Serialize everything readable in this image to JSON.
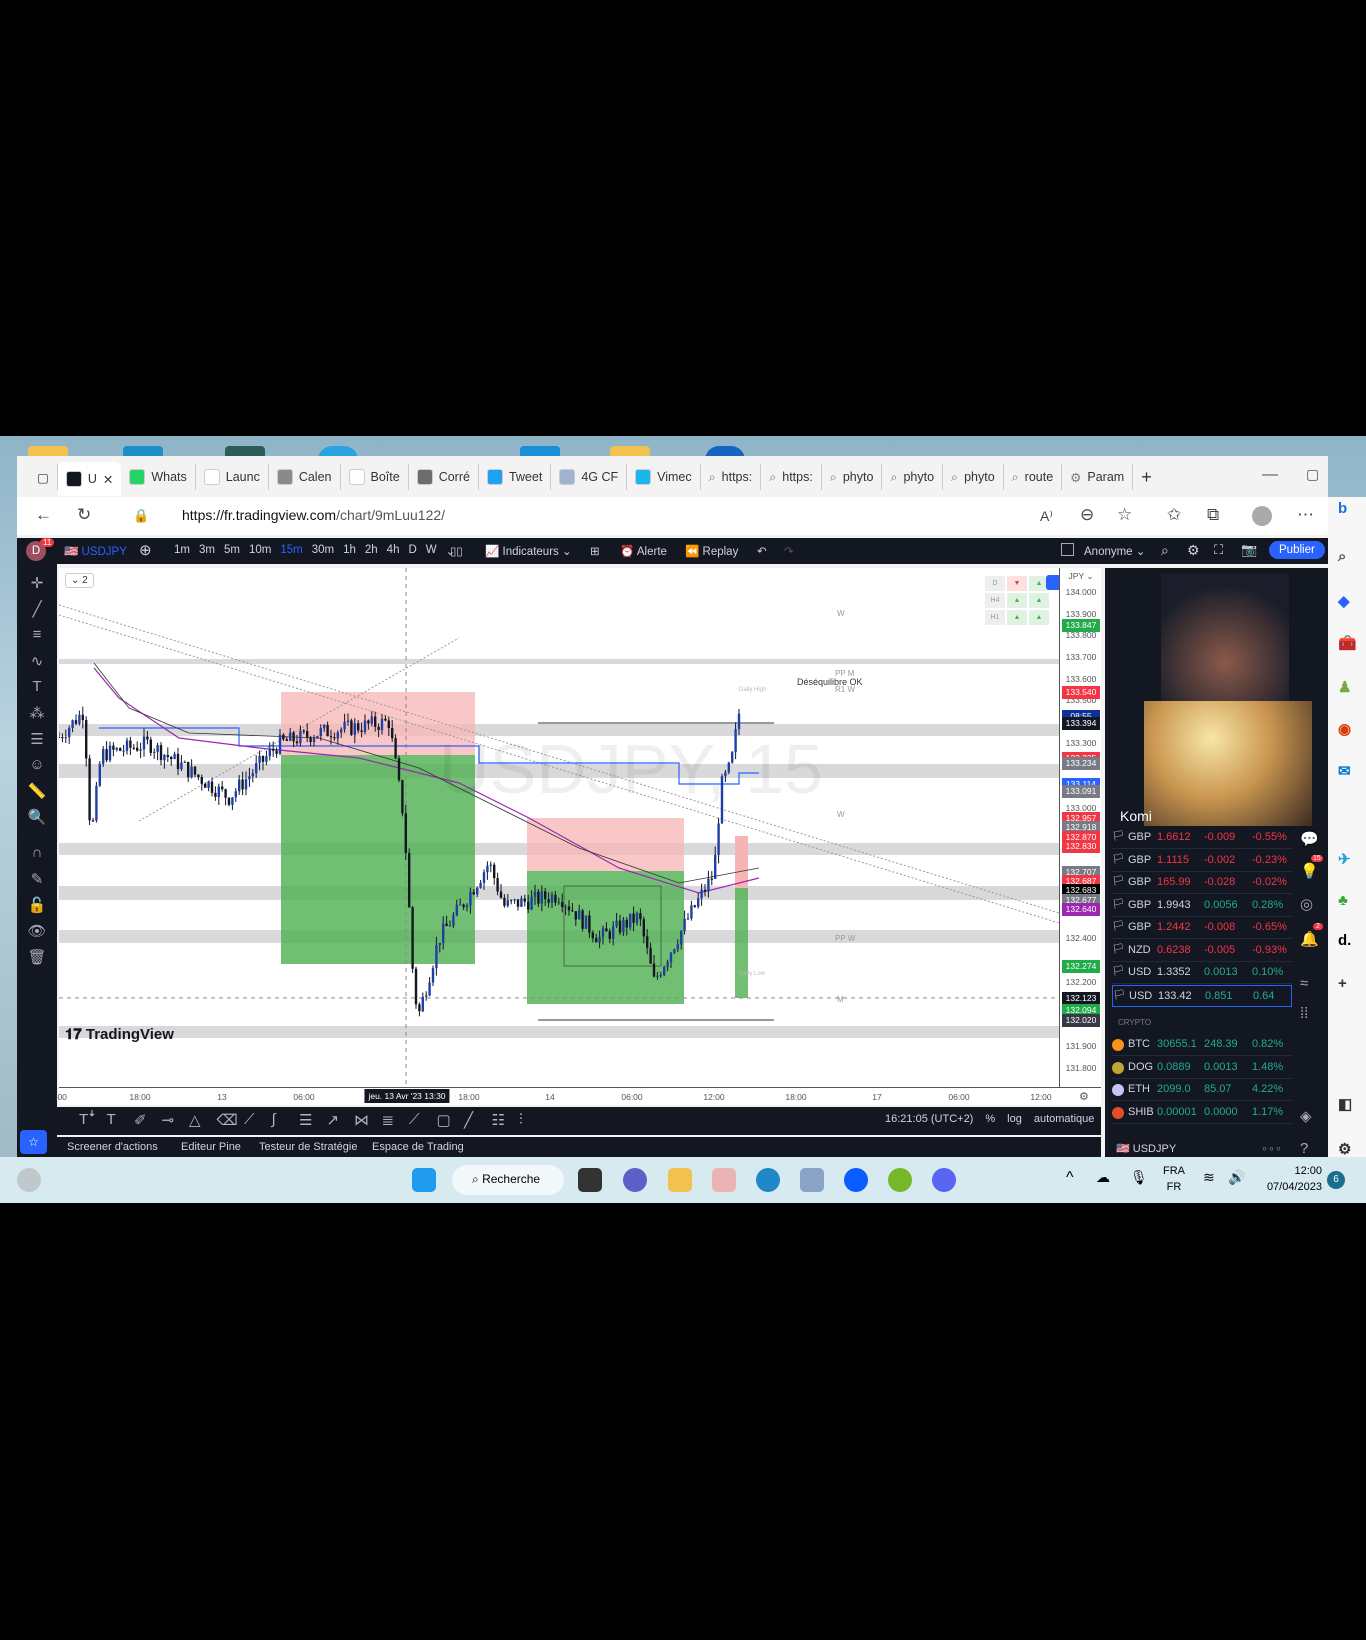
{
  "browser": {
    "tabs": [
      {
        "label": "U",
        "active": true
      },
      {
        "label": "Whats"
      },
      {
        "label": "Launc"
      },
      {
        "label": "Calen"
      },
      {
        "label": "Boîte"
      },
      {
        "label": "Corré"
      },
      {
        "label": "Tweet"
      },
      {
        "label": "4G CF"
      },
      {
        "label": "Vimec"
      },
      {
        "label": "https:"
      },
      {
        "label": "https:"
      },
      {
        "label": "phyto"
      },
      {
        "label": "phyto"
      },
      {
        "label": "phyto"
      },
      {
        "label": "route"
      },
      {
        "label": "Param"
      }
    ],
    "url_host": "https://fr.tradingview.com",
    "url_path": "/chart/9mLuu122/"
  },
  "toolbar": {
    "avatar": "D",
    "notif_count": "11",
    "symbol": "USDJPY",
    "intervals": [
      "1m",
      "3m",
      "5m",
      "10m",
      "15m",
      "30m",
      "1h",
      "2h",
      "4h",
      "D",
      "W"
    ],
    "active_interval": "15m",
    "indicators": "Indicateurs",
    "alert": "Alerte",
    "replay": "Replay",
    "account": "Anonyme",
    "publish": "Publier"
  },
  "chart": {
    "layout_count": "2",
    "currency": "JPY",
    "logo": "TradingView",
    "annotations": {
      "desequilibre": "Déséquilibre OK",
      "pp_m": "PP M",
      "r1_w": "R1 W",
      "w1": "W",
      "w2": "W",
      "pp_w": "PP W",
      "m": "M",
      "daily_high": "Daily High",
      "daily_low": "Daily Low"
    },
    "mtf_table": [
      [
        "D",
        "▼",
        "▲"
      ],
      [
        "H4",
        "▲",
        "▲"
      ],
      [
        "H1",
        "▲",
        "▲"
      ]
    ],
    "price_ticks": [
      "134.000",
      "133.900",
      "133.800",
      "133.700",
      "133.600",
      "133.500",
      "133.300",
      "133.000",
      "132.400",
      "132.200",
      "131.900",
      "131.800"
    ],
    "price_labels": [
      {
        "text": "133.847",
        "price": 133.847,
        "color": "#22ab4a"
      },
      {
        "text": "133.540",
        "price": 133.54,
        "color": "#f23645"
      },
      {
        "text": "08:55",
        "price": 133.425,
        "color": "#0c3299"
      },
      {
        "text": "133.394",
        "price": 133.394,
        "color": "#131722"
      },
      {
        "text": "133.235",
        "price": 133.235,
        "color": "#f23645"
      },
      {
        "text": "133.234",
        "price": 133.21,
        "color": "#787b86"
      },
      {
        "text": "133.114",
        "price": 133.114,
        "color": "#2962ff"
      },
      {
        "text": "133.091",
        "price": 133.08,
        "color": "#787b86"
      },
      {
        "text": "132.957",
        "price": 132.957,
        "color": "#f23645"
      },
      {
        "text": "132.918",
        "price": 132.912,
        "color": "#787b86"
      },
      {
        "text": "132.870",
        "price": 132.87,
        "color": "#f23645"
      },
      {
        "text": "132.830",
        "price": 132.826,
        "color": "#f23645"
      },
      {
        "text": "132.707",
        "price": 132.707,
        "color": "#787b86"
      },
      {
        "text": "132.687",
        "price": 132.664,
        "color": "#f23645"
      },
      {
        "text": "132.683",
        "price": 132.621,
        "color": "#000000"
      },
      {
        "text": "132.677",
        "price": 132.578,
        "color": "#787b86"
      },
      {
        "text": "132.640",
        "price": 132.535,
        "color": "#9c27b0"
      },
      {
        "text": "132.274",
        "price": 132.274,
        "color": "#22ab4a"
      },
      {
        "text": "132.123",
        "price": 132.123,
        "color": "#131722"
      },
      {
        "text": "132.094",
        "price": 132.07,
        "color": "#22ab4a"
      },
      {
        "text": "132.020",
        "price": 132.02,
        "color": "#363a45"
      }
    ],
    "time_labels": [
      ":00",
      "18:00",
      "13",
      "06:00",
      "18:00",
      "14",
      "06:00",
      "12:00",
      "18:00",
      "17",
      "06:00",
      "12:00"
    ],
    "crosshair_time": "jeu. 13 Avr '23  13:30",
    "clock": "16:21:05 (UTC+2)",
    "pct": "%",
    "log": "log",
    "auto": "automatique"
  },
  "bottom_tabs": [
    "Screener d'actions",
    "Editeur Pine",
    "Testeur de Stratégie",
    "Espace de Trading"
  ],
  "webcam": {
    "name": "Komi"
  },
  "watchlist": {
    "rows": [
      {
        "sym": "GBP",
        "last": "1.6612",
        "chg": "-0.009",
        "pct": "-0.55%",
        "up": false
      },
      {
        "sym": "GBP",
        "last": "1.1115",
        "chg": "-0.002",
        "pct": "-0.23%",
        "up": false
      },
      {
        "sym": "GBP",
        "last": "165.99",
        "chg": "-0.028",
        "pct": "-0.02%",
        "up": false
      },
      {
        "sym": "GBP",
        "last": "1.9943",
        "chg": "0.0056",
        "pct": "0.28%",
        "up": true
      },
      {
        "sym": "GBP",
        "last": "1.2442",
        "chg": "-0.008",
        "pct": "-0.65%",
        "up": false
      },
      {
        "sym": "NZD",
        "last": "0.6238",
        "chg": "-0.005",
        "pct": "-0.93%",
        "up": false
      },
      {
        "sym": "USD",
        "last": "1.3352",
        "chg": "0.0013",
        "pct": "0.10%",
        "up": true
      },
      {
        "sym": "USD",
        "last": "133.42",
        "chg": "0.851",
        "pct": "0.64",
        "up": true
      }
    ],
    "crypto_label": "CRYPTO",
    "crypto": [
      {
        "sym": "BTC",
        "last": "30655.1",
        "chg": "248.39",
        "pct": "0.82%",
        "color": "#f7931a"
      },
      {
        "sym": "DOG",
        "last": "0.0889",
        "chg": "0.0013",
        "pct": "1.48%",
        "color": "#c2a633"
      },
      {
        "sym": "ETH",
        "last": "2099.0",
        "chg": "85.07",
        "pct": "4.22%",
        "color": "#c9c3f5"
      },
      {
        "sym": "SHIB",
        "last": "0.00001",
        "chg": "0.0000",
        "pct": "1.17%",
        "color": "#e44d26"
      }
    ],
    "footer_symbol": "USDJPY",
    "ideas_badge": "15",
    "alerts_badge": "2"
  },
  "taskbar": {
    "search": "Recherche",
    "lang1": "FRA",
    "lang2": "FR",
    "time": "12:00",
    "date": "07/04/2023",
    "notif": "6"
  }
}
